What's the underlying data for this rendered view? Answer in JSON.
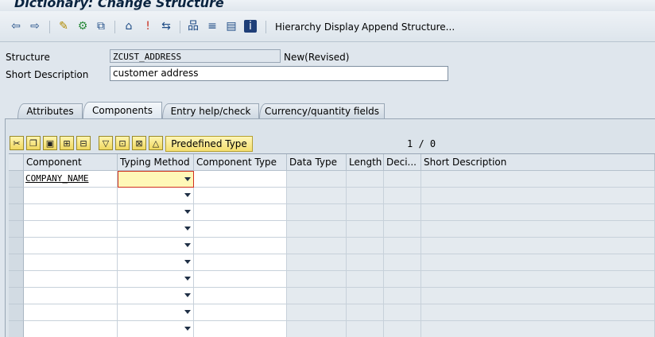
{
  "window": {
    "title": "Dictionary: Change Structure"
  },
  "toolbar": {
    "icons": [
      "back-icon",
      "forward-icon",
      "check-icon",
      "activate-icon",
      "display-change-icon",
      "where-used-icon",
      "info-icon",
      "navigate-icon",
      "hierarchy-icon",
      "list-icon",
      "menu-icon",
      "help-icon"
    ],
    "hierarchy_display": "Hierarchy Display",
    "append_structure": "Append Structure..."
  },
  "form": {
    "structure_label": "Structure",
    "structure_value": "ZCUST_ADDRESS",
    "status": "New(Revised)",
    "short_desc_label": "Short Description",
    "short_desc_value": "customer address"
  },
  "tabs": [
    {
      "label": "Attributes"
    },
    {
      "label": "Components",
      "active": true
    },
    {
      "label": "Entry help/check"
    },
    {
      "label": "Currency/quantity fields"
    }
  ],
  "table_toolbar": {
    "predefined_type": "Predefined Type",
    "counter": "1 / 0"
  },
  "columns": [
    "Component",
    "Typing Method",
    "Component Type",
    "Data Type",
    "Length",
    "Deci...",
    "Short Description"
  ],
  "rows": [
    {
      "component": "COMPANY_NAME",
      "typing_method": ""
    },
    {
      "component": "",
      "typing_method": ""
    },
    {
      "component": "",
      "typing_method": ""
    },
    {
      "component": "",
      "typing_method": ""
    },
    {
      "component": "",
      "typing_method": ""
    },
    {
      "component": "",
      "typing_method": ""
    },
    {
      "component": "",
      "typing_method": ""
    },
    {
      "component": "",
      "typing_method": ""
    },
    {
      "component": "",
      "typing_method": ""
    },
    {
      "component": "",
      "typing_method": ""
    }
  ]
}
